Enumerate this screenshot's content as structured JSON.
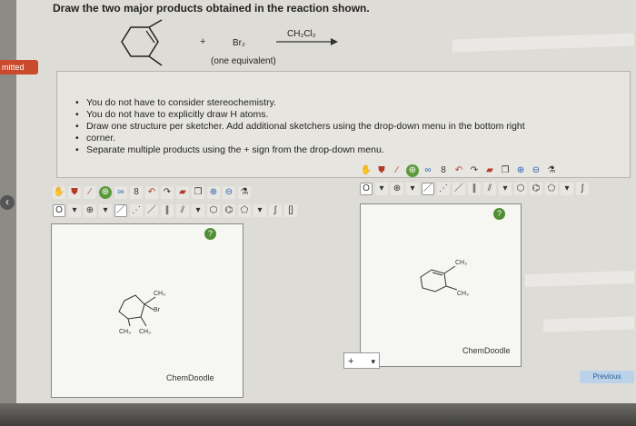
{
  "sidebar": {
    "status_tag": "mitted",
    "back_icon": "back-arrow-icon"
  },
  "question": "Draw the two major products obtained in the reaction shown.",
  "reaction": {
    "plus": "+",
    "reagent": "Br₂",
    "equivalents": "(one equivalent)",
    "solvent": "CH₂Cl₂"
  },
  "instructions": [
    "You do not have to consider stereochemistry.",
    "You do not have to explicitly draw H atoms.",
    "Draw one structure per sketcher. Add additional sketchers using the drop-down menu in the bottom right",
    "corner.",
    "Separate multiple products using the + sign from the drop-down menu."
  ],
  "sketcher1": {
    "help": "?",
    "brand": "ChemDoodle",
    "labels": {
      "ch3_top": "CH₃",
      "br": "Br",
      "ch3_left": "CH₃",
      "ch3_right": "CH₃"
    }
  },
  "sketcher2": {
    "help": "?",
    "brand": "ChemDoodle",
    "labels": {
      "ch3_top": "CH₃",
      "ch3_right": "CH₃"
    }
  },
  "add_menu": {
    "value": "+"
  },
  "navigation": {
    "previous": "Previous"
  }
}
